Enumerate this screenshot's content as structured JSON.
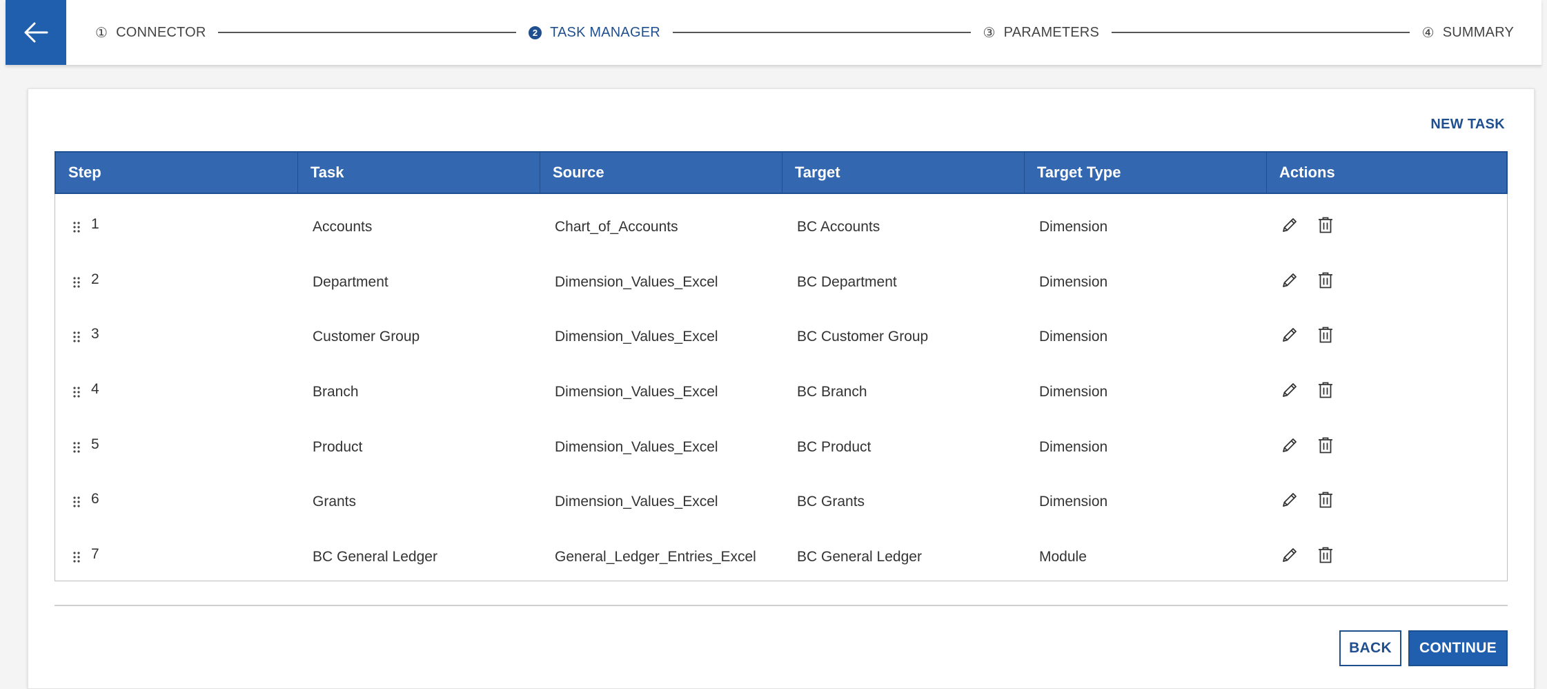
{
  "stepper": {
    "steps": [
      {
        "number": "①",
        "label": "CONNECTOR",
        "active": false
      },
      {
        "number": "2",
        "label": "TASK MANAGER",
        "active": true
      },
      {
        "number": "③",
        "label": "PARAMETERS",
        "active": false
      },
      {
        "number": "④",
        "label": "SUMMARY",
        "active": false
      }
    ]
  },
  "toolbar": {
    "new_task_label": "NEW TASK"
  },
  "table": {
    "columns": [
      "Step",
      "Task",
      "Source",
      "Target",
      "Target Type",
      "Actions"
    ],
    "rows": [
      {
        "step": "1",
        "task": "Accounts",
        "source": "Chart_of_Accounts",
        "target": "BC Accounts",
        "target_type": "Dimension"
      },
      {
        "step": "2",
        "task": "Department",
        "source": "Dimension_Values_Excel",
        "target": "BC Department",
        "target_type": "Dimension"
      },
      {
        "step": "3",
        "task": "Customer Group",
        "source": "Dimension_Values_Excel",
        "target": "BC Customer Group",
        "target_type": "Dimension"
      },
      {
        "step": "4",
        "task": "Branch",
        "source": "Dimension_Values_Excel",
        "target": "BC Branch",
        "target_type": "Dimension"
      },
      {
        "step": "5",
        "task": "Product",
        "source": "Dimension_Values_Excel",
        "target": "BC Product",
        "target_type": "Dimension"
      },
      {
        "step": "6",
        "task": "Grants",
        "source": "Dimension_Values_Excel",
        "target": "BC Grants",
        "target_type": "Dimension"
      },
      {
        "step": "7",
        "task": "BC General Ledger",
        "source": "General_Ledger_Entries_Excel",
        "target": "BC General Ledger",
        "target_type": "Module"
      }
    ]
  },
  "footer": {
    "back_label": "BACK",
    "continue_label": "CONTINUE"
  },
  "icons": {
    "back": "arrow-left-icon",
    "drag": "drag-handle-icon",
    "edit": "pencil-icon",
    "delete": "trash-icon"
  },
  "colors": {
    "accent": "#1f5fae",
    "header": "#3368b0",
    "link": "#1f4f8f"
  }
}
